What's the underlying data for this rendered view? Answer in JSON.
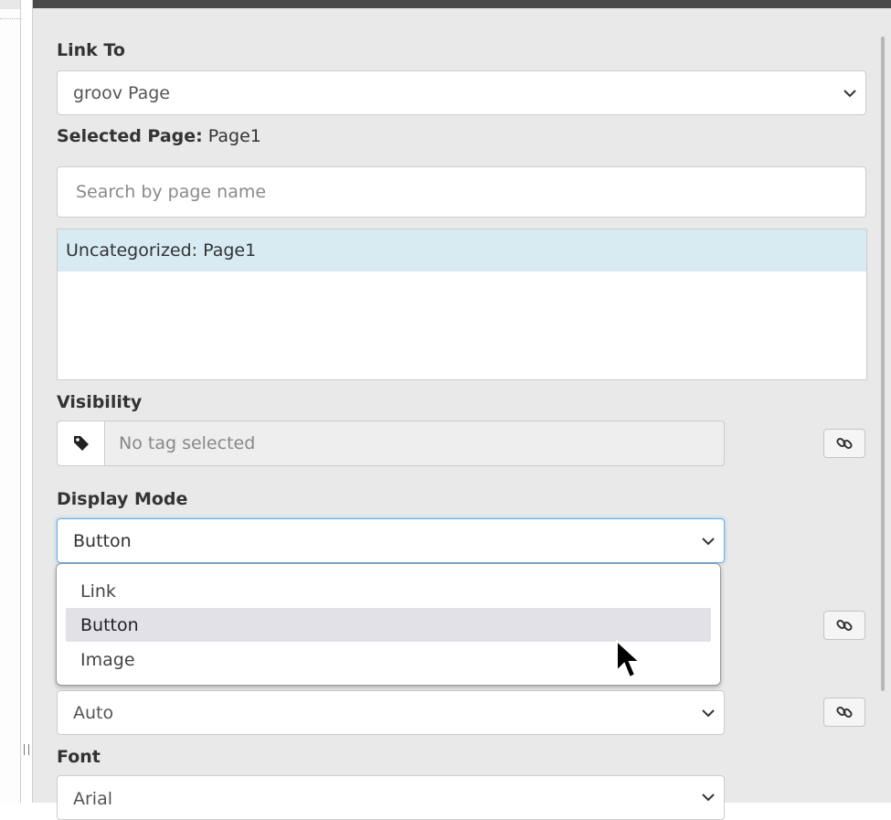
{
  "link_to": {
    "label": "Link To",
    "value": "groov Page"
  },
  "selected_page": {
    "label": "Selected Page:",
    "value": "Page1"
  },
  "search": {
    "placeholder": "Search by page name"
  },
  "page_list": {
    "items": [
      {
        "label": "Uncategorized: Page1",
        "selected": true
      }
    ]
  },
  "visibility": {
    "label": "Visibility",
    "placeholder": "No tag selected"
  },
  "display_mode": {
    "label": "Display Mode",
    "value": "Button",
    "options": [
      "Link",
      "Button",
      "Image"
    ],
    "highlighted": "Button"
  },
  "size_select": {
    "value": "Auto"
  },
  "font": {
    "label": "Font",
    "value": "Arial"
  },
  "colors": {
    "panel_bg": "#e9e9e9",
    "focus_border": "#66afe9",
    "selected_row": "#d8ebf3",
    "highlight_option": "#e2e1e8"
  },
  "icons": {
    "tag": "tag-icon",
    "link": "link-icon",
    "chevron": "chevron-down-icon",
    "cursor": "mouse-pointer"
  }
}
